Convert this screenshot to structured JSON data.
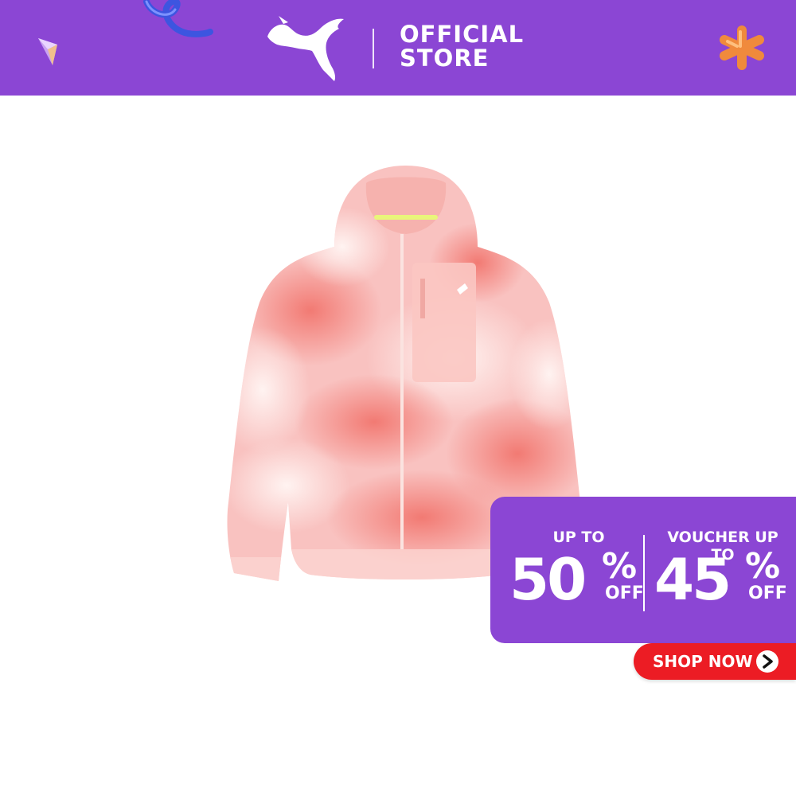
{
  "header": {
    "brand_logo": "puma-cat-logo",
    "store_line1": "OFFICIAL",
    "store_line2": "STORE",
    "background_color": "#8b46d4"
  },
  "product": {
    "image": "pink-tie-dye-hooded-running-jacket",
    "print_colors": [
      "#f9c2c0",
      "#f27a73",
      "#fde6e3"
    ]
  },
  "promo": {
    "left_label": "UP TO",
    "left_value": "50",
    "left_percent": "%",
    "left_suffix": "OFF",
    "right_label": "VOUCHER UP TO",
    "right_value": "45",
    "right_percent": "%",
    "right_suffix": "OFF",
    "background_color": "#8b46d4"
  },
  "cta": {
    "label": "SHOP NOW",
    "icon": "chevron-right-icon",
    "background_color": "#ec1c24"
  },
  "decorations": [
    "blue-squiggle",
    "purple-gem",
    "orange-asterisk"
  ]
}
